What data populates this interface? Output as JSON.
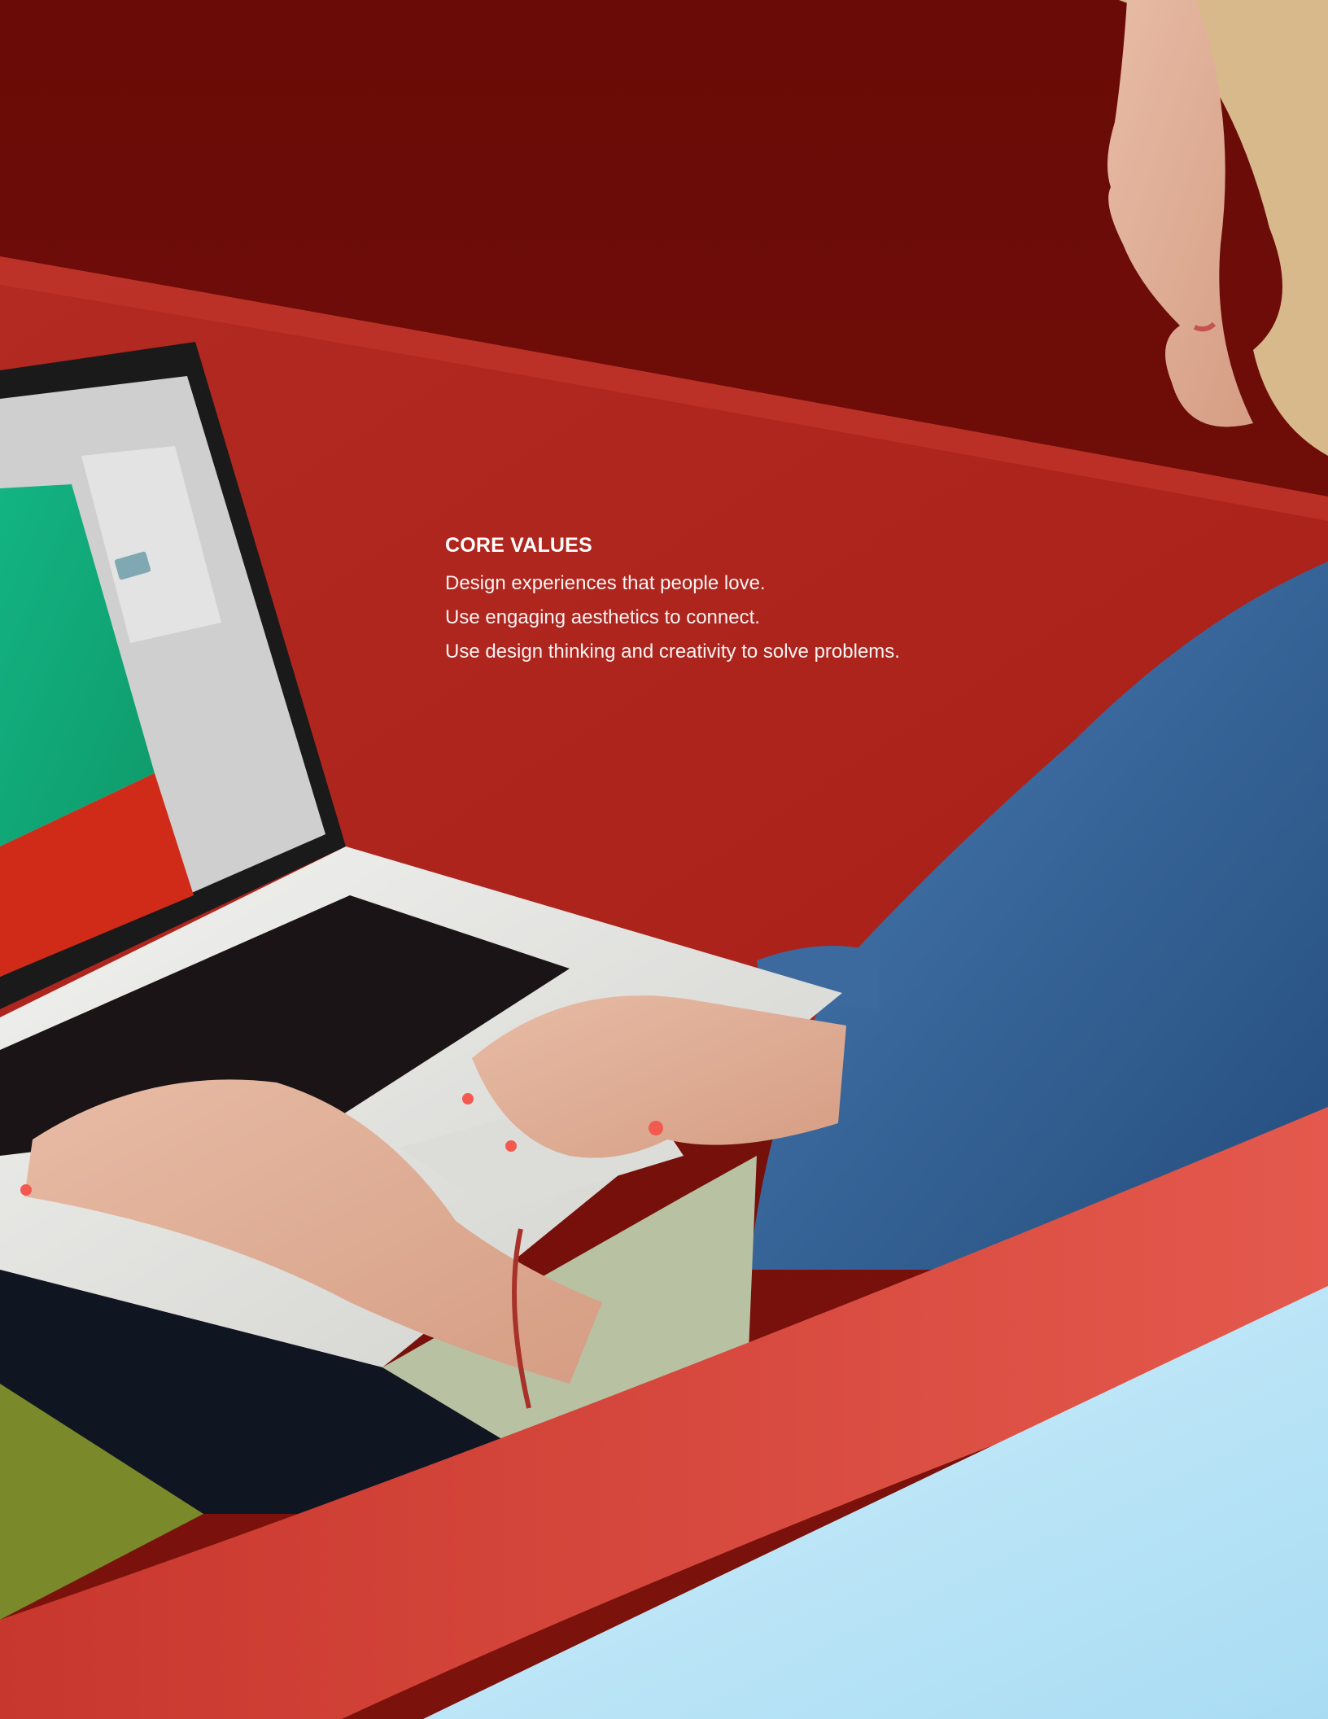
{
  "core_values": {
    "heading": "CORE VALUES",
    "items": [
      "Design experiences that people love.",
      "Use engaging aesthetics to connect.",
      "Use design thinking and creativity to solve problems."
    ]
  },
  "colors": {
    "background_wall": "#6e0d09",
    "sofa_red": "#b8231d",
    "sofa_arm": "#e04a3f",
    "shirt_blue": "#2f5f95",
    "pillow_light_blue": "#b9e4f6",
    "screen_green": "#17a878",
    "laptop_silver": "#e6e6e4",
    "text_white": "#ffffff"
  },
  "photo": {
    "subject": "woman-typing-on-laptop-on-red-sofa"
  }
}
